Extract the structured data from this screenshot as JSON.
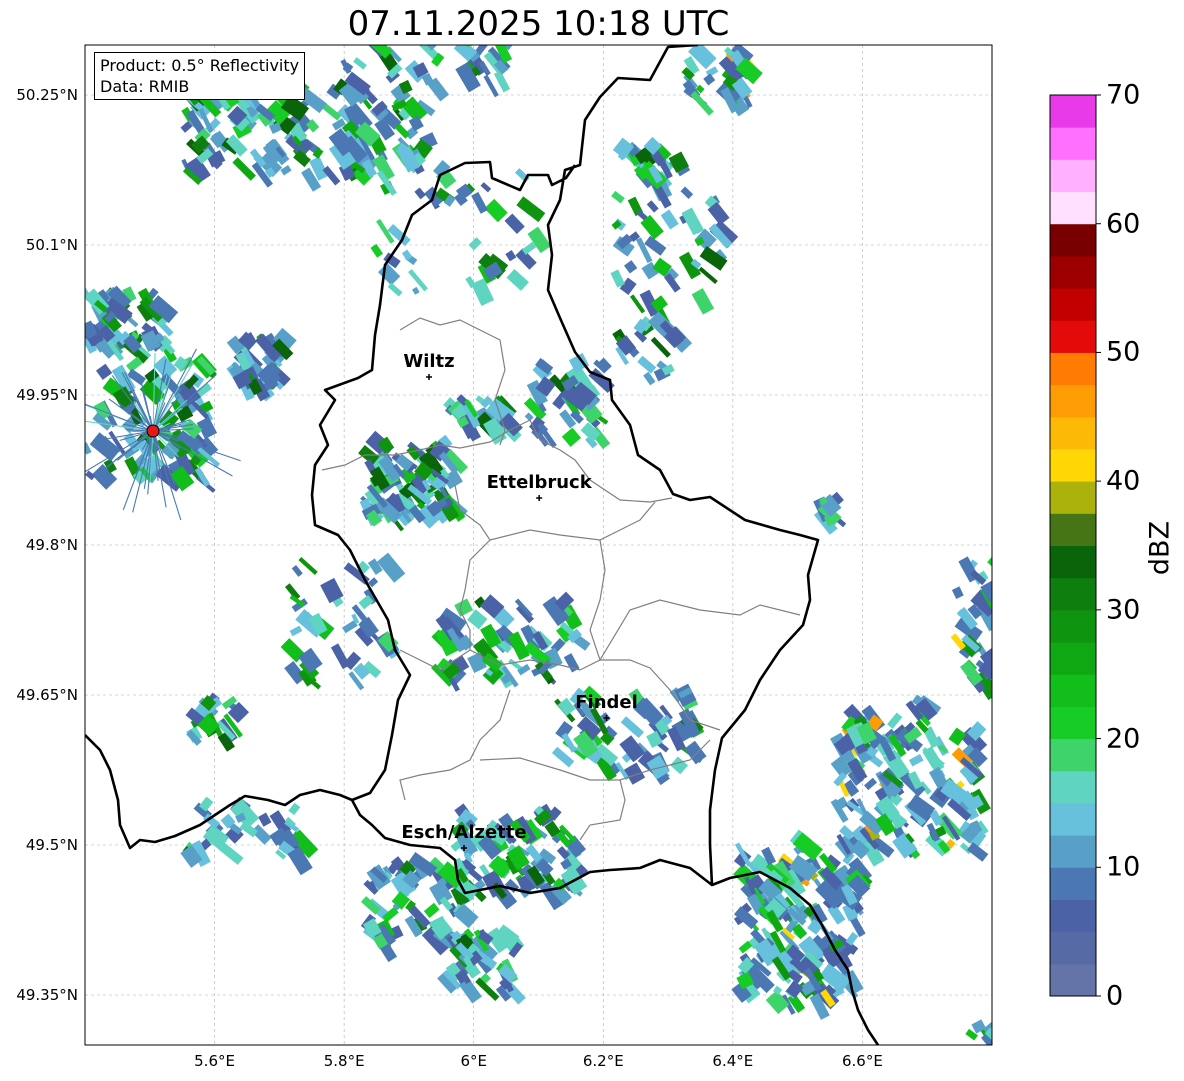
{
  "title": "07.11.2025 10:18 UTC",
  "info": {
    "product": "Product: 0.5° Reflectivity",
    "data": "Data: RMIB"
  },
  "axes": {
    "lon_range": [
      5.4,
      6.8
    ],
    "lat_range": [
      49.3,
      50.3
    ],
    "lat_ticks": [
      {
        "value": 50.25,
        "label": "50.25°N"
      },
      {
        "value": 50.1,
        "label": "50.1°N"
      },
      {
        "value": 49.95,
        "label": "49.95°N"
      },
      {
        "value": 49.8,
        "label": "49.8°N"
      },
      {
        "value": 49.65,
        "label": "49.65°N"
      },
      {
        "value": 49.5,
        "label": "49.5°N"
      },
      {
        "value": 49.35,
        "label": "49.35°N"
      }
    ],
    "lon_ticks": [
      {
        "value": 5.6,
        "label": "5.6°E"
      },
      {
        "value": 5.8,
        "label": "5.8°E"
      },
      {
        "value": 6.0,
        "label": "6°E"
      },
      {
        "value": 6.2,
        "label": "6.2°E"
      },
      {
        "value": 6.4,
        "label": "6.4°E"
      },
      {
        "value": 6.6,
        "label": "6.6°E"
      }
    ],
    "grid": true
  },
  "cities": [
    {
      "name": "Wiltz",
      "lon": 5.931,
      "lat": 49.968
    },
    {
      "name": "Ettelbruck",
      "lon": 6.101,
      "lat": 49.847
    },
    {
      "name": "Findel",
      "lon": 6.205,
      "lat": 49.627
    },
    {
      "name": "Esch/Alzette",
      "lon": 5.985,
      "lat": 49.497
    }
  ],
  "radar_site": {
    "lon": 5.505,
    "lat": 49.914,
    "color": "#e31a1c"
  },
  "colorbar": {
    "label": "dBZ",
    "min": 0,
    "max": 70,
    "ticks": [
      0,
      10,
      20,
      30,
      40,
      50,
      60,
      70
    ],
    "colors": [
      "#6474a8",
      "#566aa6",
      "#4b63a6",
      "#4b78b3",
      "#58a0c8",
      "#67c1dc",
      "#5ed4c1",
      "#3fd46b",
      "#16cc25",
      "#12be1a",
      "#10a812",
      "#0f9410",
      "#0e7f0e",
      "#0a640a",
      "#457514",
      "#abb20b",
      "#fed705",
      "#fcb905",
      "#fd9d03",
      "#ff7b01",
      "#e50a0a",
      "#c20000",
      "#9c0000",
      "#780000",
      "#ffe0ff",
      "#ffb0ff",
      "#ff70ff",
      "#e93ae9"
    ]
  }
}
